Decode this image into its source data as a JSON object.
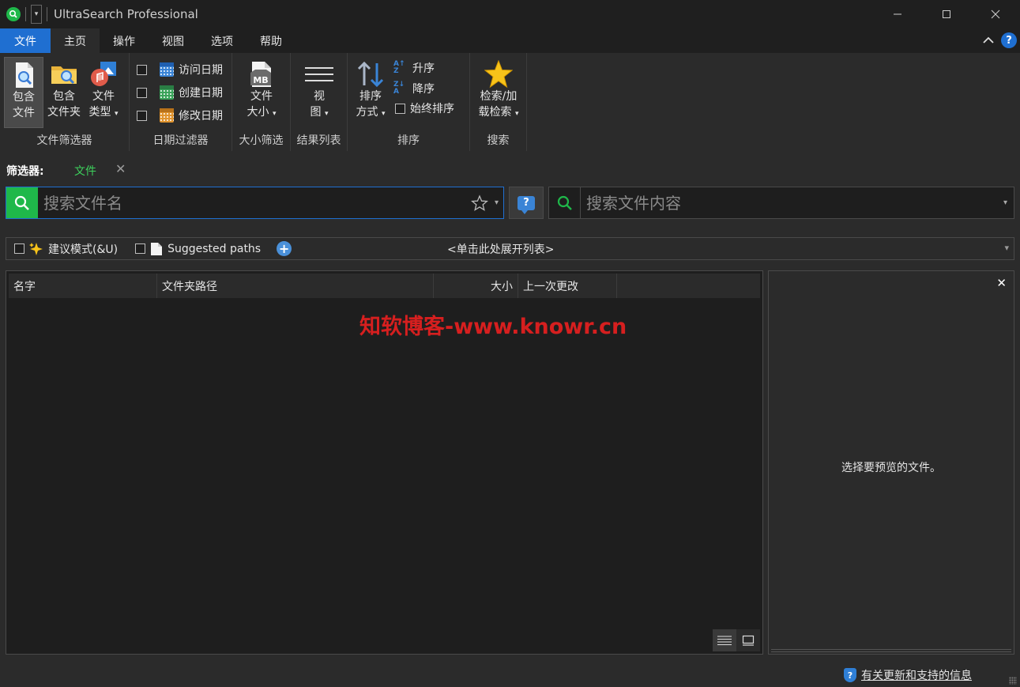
{
  "window": {
    "title": "UltraSearch Professional"
  },
  "menu": {
    "tabs": [
      {
        "label": "文件",
        "name": "tab-file"
      },
      {
        "label": "主页",
        "name": "tab-home"
      },
      {
        "label": "操作",
        "name": "tab-actions"
      },
      {
        "label": "视图",
        "name": "tab-view"
      },
      {
        "label": "选项",
        "name": "tab-options"
      },
      {
        "label": "帮助",
        "name": "tab-help"
      }
    ],
    "help_glyph": "?"
  },
  "ribbon": {
    "file_filter": {
      "group_label": "文件筛选器",
      "include_files_l1": "包含",
      "include_files_l2": "文件",
      "include_folders_l1": "包含",
      "include_folders_l2": "文件夹",
      "file_types_l1": "文件",
      "file_types_l2": "类型"
    },
    "date_filter": {
      "group_label": "日期过滤器",
      "accessed": "访问日期",
      "created": "创建日期",
      "modified": "修改日期"
    },
    "size_filter": {
      "group_label": "大小筛选",
      "btn_l1": "文件",
      "btn_l2": "大小",
      "icon_text": "MB"
    },
    "result_list": {
      "group_label": "结果列表",
      "btn_l1": "视",
      "btn_l2": "图"
    },
    "sort": {
      "group_label": "排序",
      "btn_l1": "排序",
      "btn_l2": "方式",
      "ascending": "升序",
      "descending": "降序",
      "always_sort": "始终排序"
    },
    "search": {
      "group_label": "搜索",
      "btn_l1": "检索/加",
      "btn_l2": "载检索"
    }
  },
  "filter_bar": {
    "label": "筛选器:",
    "chip": "文件"
  },
  "search": {
    "filename_placeholder": "搜索文件名",
    "content_placeholder": "搜索文件内容",
    "help_glyph": "?"
  },
  "options": {
    "suggest_mode": "建议模式(&U)",
    "suggested_paths": "Suggested paths",
    "expand_list": "<单击此处展开列表>"
  },
  "results": {
    "columns": [
      "名字",
      "文件夹路径",
      "大小",
      "上一次更改"
    ],
    "watermark": "知软博客-www.knowr.cn"
  },
  "preview": {
    "message": "选择要预览的文件。"
  },
  "status": {
    "support_link": "有关更新和支持的信息"
  },
  "colors": {
    "accent_blue": "#1f6fd1",
    "brand_green": "#1fb84a",
    "watermark_red": "#d61f1f"
  }
}
